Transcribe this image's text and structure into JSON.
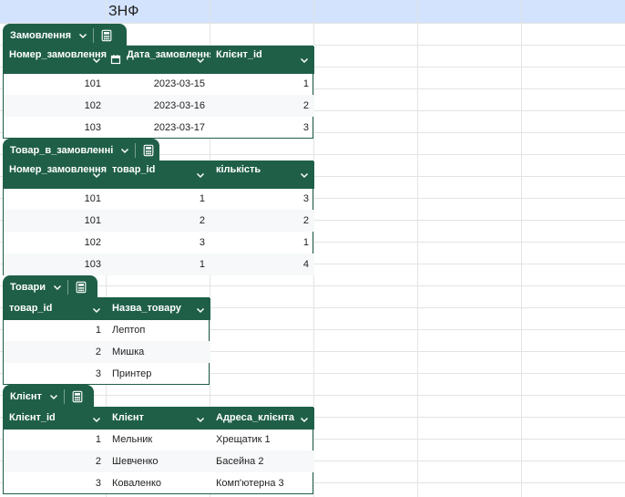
{
  "sheet": {
    "a1_title": "ЗНФ"
  },
  "tables": {
    "orders": {
      "name": "Замовлення",
      "headers": [
        "Номер_замовлення",
        "Дата_замовлення",
        "Клієнт_id"
      ],
      "rows": [
        [
          "101",
          "2023-03-15",
          "1"
        ],
        [
          "102",
          "2023-03-16",
          "2"
        ],
        [
          "103",
          "2023-03-17",
          "3"
        ]
      ]
    },
    "order_items": {
      "name": "Товар_в_замовленні",
      "headers": [
        "Номер_замовлення",
        "товар_id",
        "кількість"
      ],
      "rows": [
        [
          "101",
          "1",
          "3"
        ],
        [
          "101",
          "2",
          "2"
        ],
        [
          "102",
          "3",
          "1"
        ],
        [
          "103",
          "1",
          "4"
        ]
      ]
    },
    "products": {
      "name": "Товари",
      "headers": [
        "товар_id",
        "Назва_товару"
      ],
      "rows": [
        [
          "1",
          "Лептоп"
        ],
        [
          "2",
          "Мишка"
        ],
        [
          "3",
          "Принтер"
        ]
      ]
    },
    "client": {
      "name": "Клієнт",
      "headers": [
        "Клієнт_id",
        "Клієнт",
        "Адреса_клієнта"
      ],
      "rows": [
        [
          "1",
          "Мельник",
          "Хрещатик 1"
        ],
        [
          "2",
          "Шевченко",
          "Басейна 2"
        ],
        [
          "3",
          "Коваленко",
          "Комп'ютерна 3"
        ]
      ]
    }
  },
  "icons": {
    "dropdown": "chevron-down-icon",
    "calculator": "calculator-icon",
    "calendar": "calendar-icon"
  },
  "colors": {
    "table_header": "#1f5f48",
    "selected_row": "#d3e3fd",
    "gridline": "#e2e3e3"
  }
}
